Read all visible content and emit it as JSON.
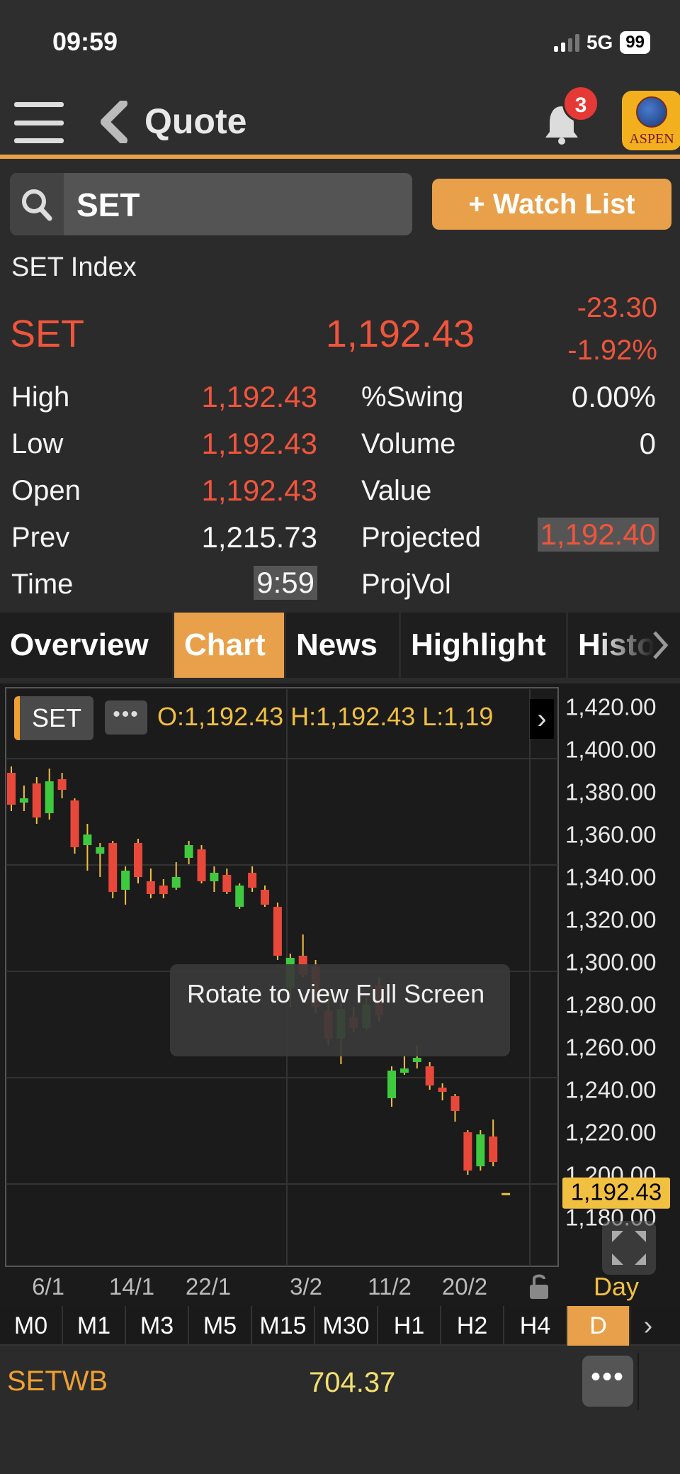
{
  "status_bar": {
    "time": "09:59",
    "network": "5G",
    "battery": "99"
  },
  "header": {
    "title": "Quote",
    "notification_count": "3",
    "logo_text": "ASPEN"
  },
  "search": {
    "value": "SET"
  },
  "watchlist_button": "+ Watch List",
  "quote": {
    "name": "SET Index",
    "symbol": "SET",
    "last": "1,192.43",
    "change": "-23.30",
    "change_pct": "-1.92%",
    "left_stats": [
      {
        "label": "High",
        "value": "1,192.43"
      },
      {
        "label": "Low",
        "value": "1,192.43"
      },
      {
        "label": "Open",
        "value": "1,192.43"
      },
      {
        "label": "Prev",
        "value": "1,215.73"
      },
      {
        "label": "Time",
        "value": "9:59"
      }
    ],
    "right_stats": [
      {
        "label": "%Swing",
        "value": "0.00%"
      },
      {
        "label": "Volume",
        "value": "0"
      },
      {
        "label": "Value",
        "value": ""
      },
      {
        "label": "Projected",
        "value": "1,192.40"
      },
      {
        "label": "ProjVol",
        "value": ""
      }
    ]
  },
  "tabs": [
    {
      "label": "Overview",
      "active": false
    },
    {
      "label": "Chart",
      "active": true
    },
    {
      "label": "News",
      "active": false
    },
    {
      "label": "Highlight",
      "active": false
    },
    {
      "label": "Histor",
      "active": false
    }
  ],
  "chart": {
    "symbol_chip": "SET",
    "ohlc_text": "O:1,192.43  H:1,192.43  L:1,19",
    "tooltip": "Rotate to view Full Screen",
    "period": "Day",
    "y_ticks": [
      "1,420.00",
      "1,400.00",
      "1,380.00",
      "1,360.00",
      "1,340.00",
      "1,320.00",
      "1,300.00",
      "1,280.00",
      "1,260.00",
      "1,240.00",
      "1,220.00",
      "1,200.00",
      "1,180.00"
    ],
    "x_ticks": [
      "6/1",
      "14/1",
      "22/1",
      "3/2",
      "11/2",
      "20/2"
    ],
    "current_price_label": "1,192.43",
    "colors": {
      "up": "#3ec93e",
      "down": "#e8483a",
      "accent": "#e8a04a",
      "price_tag": "#f2c040"
    }
  },
  "chart_data": {
    "type": "candlestick",
    "ylim": [
      1170,
      1430
    ],
    "candles": [
      {
        "o": 1390,
        "h": 1393,
        "l": 1372,
        "c": 1375
      },
      {
        "o": 1376,
        "h": 1384,
        "l": 1372,
        "c": 1378
      },
      {
        "o": 1385,
        "h": 1388,
        "l": 1366,
        "c": 1369
      },
      {
        "o": 1371,
        "h": 1392,
        "l": 1368,
        "c": 1386
      },
      {
        "o": 1387,
        "h": 1390,
        "l": 1378,
        "c": 1382
      },
      {
        "o": 1377,
        "h": 1378,
        "l": 1352,
        "c": 1355
      },
      {
        "o": 1356,
        "h": 1366,
        "l": 1344,
        "c": 1361
      },
      {
        "o": 1352,
        "h": 1357,
        "l": 1341,
        "c": 1355
      },
      {
        "o": 1357,
        "h": 1358,
        "l": 1331,
        "c": 1334
      },
      {
        "o": 1335,
        "h": 1346,
        "l": 1328,
        "c": 1344
      },
      {
        "o": 1357,
        "h": 1359,
        "l": 1338,
        "c": 1341
      },
      {
        "o": 1339,
        "h": 1345,
        "l": 1331,
        "c": 1333
      },
      {
        "o": 1337,
        "h": 1340,
        "l": 1331,
        "c": 1333
      },
      {
        "o": 1336,
        "h": 1348,
        "l": 1335,
        "c": 1341
      },
      {
        "o": 1350,
        "h": 1358,
        "l": 1347,
        "c": 1356
      },
      {
        "o": 1354,
        "h": 1356,
        "l": 1338,
        "c": 1339
      },
      {
        "o": 1339,
        "h": 1346,
        "l": 1334,
        "c": 1343
      },
      {
        "o": 1342,
        "h": 1345,
        "l": 1333,
        "c": 1334
      },
      {
        "o": 1327,
        "h": 1338,
        "l": 1326,
        "c": 1337
      },
      {
        "o": 1343,
        "h": 1346,
        "l": 1334,
        "c": 1336
      },
      {
        "o": 1335,
        "h": 1337,
        "l": 1327,
        "c": 1328
      },
      {
        "o": 1327,
        "h": 1329,
        "l": 1302,
        "c": 1304
      },
      {
        "o": 1289,
        "h": 1305,
        "l": 1280,
        "c": 1303
      },
      {
        "o": 1304,
        "h": 1314,
        "l": 1294,
        "c": 1295
      },
      {
        "o": 1299,
        "h": 1302,
        "l": 1277,
        "c": 1280
      },
      {
        "o": 1278,
        "h": 1285,
        "l": 1262,
        "c": 1265
      },
      {
        "o": 1265,
        "h": 1282,
        "l": 1253,
        "c": 1279
      },
      {
        "o": 1275,
        "h": 1280,
        "l": 1268,
        "c": 1270
      },
      {
        "o": 1270,
        "h": 1284,
        "l": 1269,
        "c": 1281
      },
      {
        "o": 1290,
        "h": 1294,
        "l": 1273,
        "c": 1276
      },
      {
        "o": 1237,
        "h": 1252,
        "l": 1233,
        "c": 1250
      },
      {
        "o": 1249,
        "h": 1257,
        "l": 1248,
        "c": 1251
      },
      {
        "o": 1254,
        "h": 1262,
        "l": 1251,
        "c": 1256
      },
      {
        "o": 1252,
        "h": 1254,
        "l": 1241,
        "c": 1243
      },
      {
        "o": 1242,
        "h": 1244,
        "l": 1236,
        "c": 1240
      },
      {
        "o": 1238,
        "h": 1239,
        "l": 1226,
        "c": 1231
      },
      {
        "o": 1221,
        "h": 1222,
        "l": 1201,
        "c": 1203
      },
      {
        "o": 1205,
        "h": 1222,
        "l": 1203,
        "c": 1220
      },
      {
        "o": 1219,
        "h": 1227,
        "l": 1205,
        "c": 1207
      },
      {
        "o": 1192.43,
        "h": 1192.43,
        "l": 1192.43,
        "c": 1192.43
      }
    ]
  },
  "timeframes": [
    {
      "label": "M0",
      "active": false
    },
    {
      "label": "M1",
      "active": false
    },
    {
      "label": "M3",
      "active": false
    },
    {
      "label": "M5",
      "active": false
    },
    {
      "label": "M15",
      "active": false
    },
    {
      "label": "M30",
      "active": false
    },
    {
      "label": "H1",
      "active": false
    },
    {
      "label": "H2",
      "active": false
    },
    {
      "label": "H4",
      "active": false
    },
    {
      "label": "D",
      "active": true
    }
  ],
  "related": {
    "symbol": "SETWB",
    "price": "704.37"
  }
}
